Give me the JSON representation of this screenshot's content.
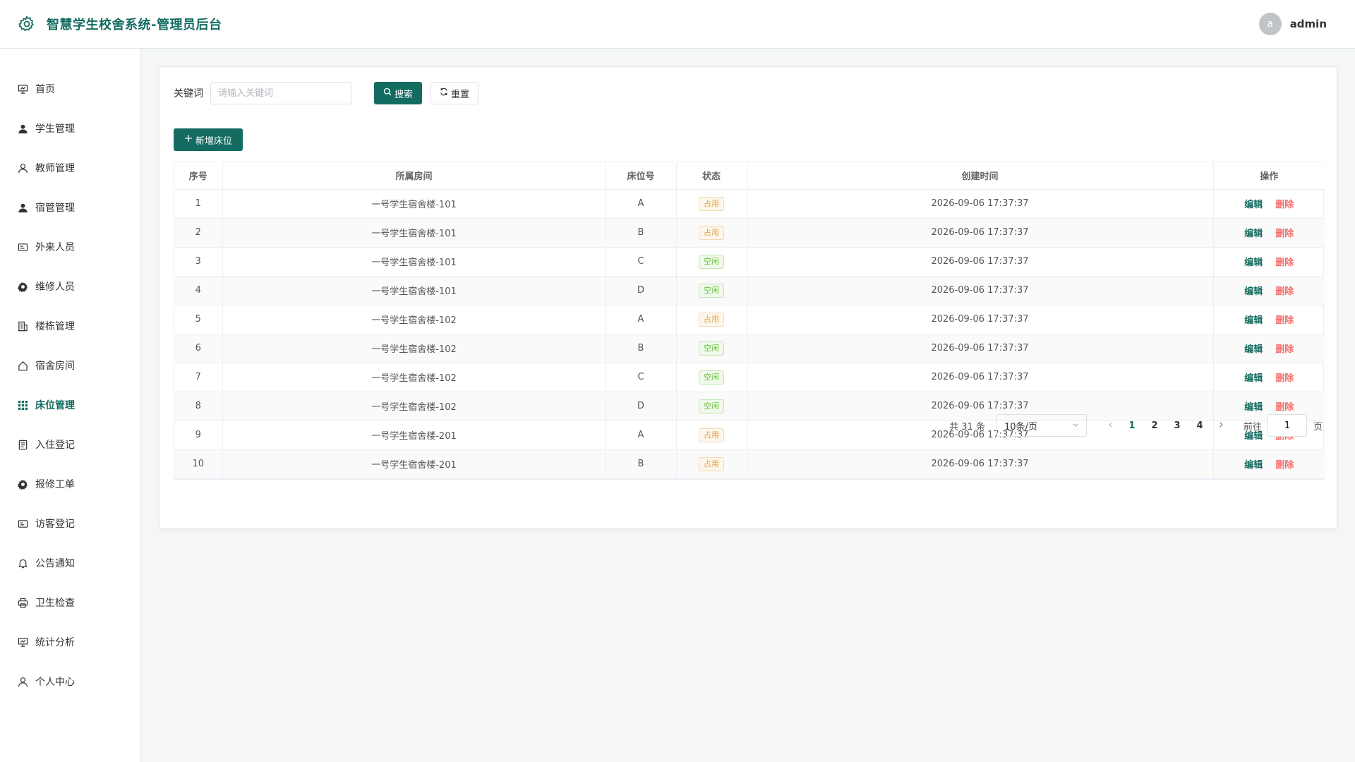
{
  "header": {
    "title": "智慧学生校舍系统-管理员后台",
    "avatar_letter": "a",
    "username": "admin",
    "icon": "gear-icon",
    "brand_color": "#146c61"
  },
  "sidebar": {
    "items": [
      {
        "label": "首页",
        "icon": "presentation-icon"
      },
      {
        "label": "学生管理",
        "icon": "user-filled-icon"
      },
      {
        "label": "教师管理",
        "icon": "user-icon"
      },
      {
        "label": "宿管管理",
        "icon": "user-filled-icon"
      },
      {
        "label": "外来人员",
        "icon": "id-card-icon"
      },
      {
        "label": "维修人员",
        "icon": "settings-icon"
      },
      {
        "label": "楼栋管理",
        "icon": "building-icon"
      },
      {
        "label": "宿舍房间",
        "icon": "house-icon"
      },
      {
        "label": "床位管理",
        "icon": "grid-icon",
        "active": true
      },
      {
        "label": "入住登记",
        "icon": "document-icon"
      },
      {
        "label": "报修工单",
        "icon": "settings-icon"
      },
      {
        "label": "访客登记",
        "icon": "id-card-icon"
      },
      {
        "label": "公告通知",
        "icon": "bell-icon"
      },
      {
        "label": "卫生检查",
        "icon": "printer-icon"
      },
      {
        "label": "统计分析",
        "icon": "presentation-icon"
      },
      {
        "label": "个人中心",
        "icon": "user-icon"
      }
    ]
  },
  "search": {
    "label": "关键词",
    "placeholder": "请输入关键词",
    "value": "",
    "search_button": "搜索",
    "reset_button": "重置"
  },
  "toolbar": {
    "add_button": "新增床位"
  },
  "table": {
    "columns": [
      "序号",
      "所属房间",
      "床位号",
      "状态",
      "创建时间",
      "操作"
    ],
    "rows": [
      {
        "index": "1",
        "room": "一号学生宿舍楼-101",
        "bed": "A",
        "status": "占用",
        "created": "2026-09-06 17:37:37"
      },
      {
        "index": "2",
        "room": "一号学生宿舍楼-101",
        "bed": "B",
        "status": "占用",
        "created": "2026-09-06 17:37:37"
      },
      {
        "index": "3",
        "room": "一号学生宿舍楼-101",
        "bed": "C",
        "status": "空闲",
        "created": "2026-09-06 17:37:37"
      },
      {
        "index": "4",
        "room": "一号学生宿舍楼-101",
        "bed": "D",
        "status": "空闲",
        "created": "2026-09-06 17:37:37"
      },
      {
        "index": "5",
        "room": "一号学生宿舍楼-102",
        "bed": "A",
        "status": "占用",
        "created": "2026-09-06 17:37:37"
      },
      {
        "index": "6",
        "room": "一号学生宿舍楼-102",
        "bed": "B",
        "status": "空闲",
        "created": "2026-09-06 17:37:37"
      },
      {
        "index": "7",
        "room": "一号学生宿舍楼-102",
        "bed": "C",
        "status": "空闲",
        "created": "2026-09-06 17:37:37"
      },
      {
        "index": "8",
        "room": "一号学生宿舍楼-102",
        "bed": "D",
        "status": "空闲",
        "created": "2026-09-06 17:37:37"
      },
      {
        "index": "9",
        "room": "一号学生宿舍楼-201",
        "bed": "A",
        "status": "占用",
        "created": "2026-09-06 17:37:37"
      },
      {
        "index": "10",
        "room": "一号学生宿舍楼-201",
        "bed": "B",
        "status": "占用",
        "created": "2026-09-06 17:37:37"
      }
    ],
    "edit_label": "编辑",
    "delete_label": "删除",
    "status_busy": "占用",
    "status_free": "空闲",
    "status_colors": {
      "busy": "#e6a23c",
      "free": "#67c23a"
    },
    "delete_color": "#f56c6c"
  },
  "pagination": {
    "total_text": "共 31 条",
    "page_size": "10条/页",
    "pages": [
      "1",
      "2",
      "3",
      "4"
    ],
    "current_page": "1",
    "goto_label": "前往",
    "goto_value": "1",
    "goto_suffix": "页"
  }
}
